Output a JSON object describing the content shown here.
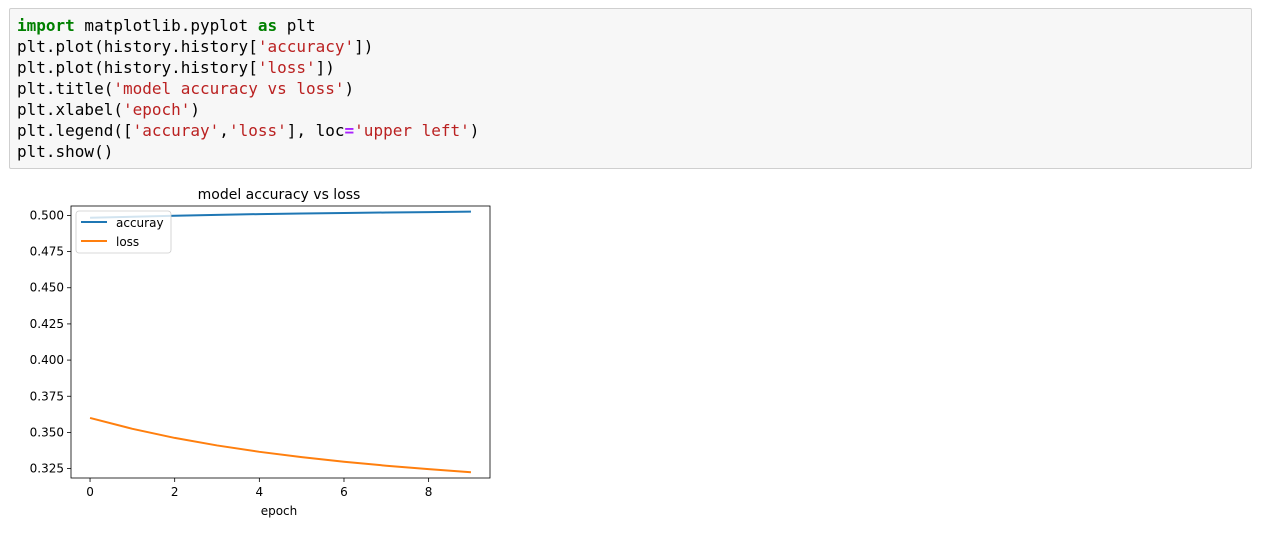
{
  "code_cell": {
    "lines": [
      [
        {
          "t": "import",
          "c": "kw"
        },
        {
          "t": " matplotlib.pyplot ",
          "c": ""
        },
        {
          "t": "as",
          "c": "kw"
        },
        {
          "t": " plt",
          "c": ""
        }
      ],
      [
        {
          "t": "plt.plot(history.history[",
          "c": ""
        },
        {
          "t": "'accuracy'",
          "c": "str"
        },
        {
          "t": "])",
          "c": ""
        }
      ],
      [
        {
          "t": "plt.plot(history.history[",
          "c": ""
        },
        {
          "t": "'loss'",
          "c": "str"
        },
        {
          "t": "])",
          "c": ""
        }
      ],
      [
        {
          "t": "plt.title(",
          "c": ""
        },
        {
          "t": "'model accuracy vs loss'",
          "c": "str"
        },
        {
          "t": ")",
          "c": ""
        }
      ],
      [
        {
          "t": "plt.xlabel(",
          "c": ""
        },
        {
          "t": "'epoch'",
          "c": "str"
        },
        {
          "t": ")",
          "c": ""
        }
      ],
      [
        {
          "t": "plt.legend([",
          "c": ""
        },
        {
          "t": "'accuray'",
          "c": "str"
        },
        {
          "t": ",",
          "c": ""
        },
        {
          "t": "'loss'",
          "c": "str"
        },
        {
          "t": "], loc",
          "c": ""
        },
        {
          "t": "=",
          "c": "op"
        },
        {
          "t": "'upper left'",
          "c": "str"
        },
        {
          "t": ")",
          "c": ""
        }
      ],
      [
        {
          "t": "plt.show()",
          "c": ""
        }
      ]
    ]
  },
  "chart_data": {
    "type": "line",
    "title": "model accuracy vs loss",
    "xlabel": "epoch",
    "ylabel": "",
    "x": [
      0,
      1,
      2,
      3,
      4,
      5,
      6,
      7,
      8,
      9
    ],
    "xlim": [
      -0.45,
      9.45
    ],
    "ylim": [
      0.3185,
      0.5065
    ],
    "xticks": [
      0,
      2,
      4,
      6,
      8
    ],
    "yticks": [
      0.325,
      0.35,
      0.375,
      0.4,
      0.425,
      0.45,
      0.475,
      0.5
    ],
    "ytick_labels": [
      "0.325",
      "0.350",
      "0.375",
      "0.400",
      "0.425",
      "0.450",
      "0.475",
      "0.500"
    ],
    "legend_position": "upper left",
    "grid": false,
    "series": [
      {
        "name": "accuray",
        "color": "#1f77b4",
        "values": [
          0.4984,
          0.4991,
          0.4998,
          0.5004,
          0.5009,
          0.5013,
          0.5017,
          0.502,
          0.5023,
          0.5026
        ]
      },
      {
        "name": "loss",
        "color": "#ff7f0e",
        "values": [
          0.36,
          0.3525,
          0.3462,
          0.341,
          0.3366,
          0.3329,
          0.3297,
          0.327,
          0.3246,
          0.3225
        ]
      }
    ]
  }
}
